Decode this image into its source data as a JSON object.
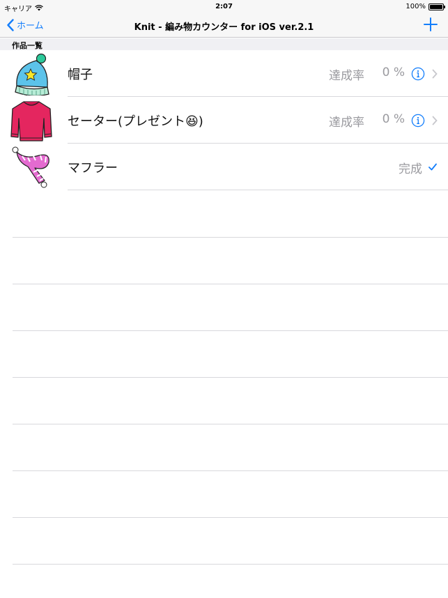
{
  "status_bar": {
    "carrier": "キャリア",
    "time": "2:07",
    "battery": "100%"
  },
  "nav": {
    "back_label": "ホーム",
    "title": "Knit - 編み物カウンター for iOS ver.2.1",
    "add_icon": "plus-icon"
  },
  "section": {
    "title": "作品一覧"
  },
  "items": [
    {
      "title": "帽子",
      "label": "達成率",
      "percent": "0 %",
      "status": "in-progress",
      "icon": "knit-hat-icon"
    },
    {
      "title": "セーター(プレゼント😆)",
      "label": "達成率",
      "percent": "0 %",
      "status": "in-progress",
      "icon": "sweater-icon"
    },
    {
      "title": "マフラー",
      "label": "完成",
      "status": "complete",
      "icon": "scarf-icon"
    }
  ],
  "colors": {
    "accent": "#147efb",
    "secondary_text": "#9a9a9f",
    "separator": "#d8d8dc",
    "nav_background": "#f7f7f7"
  }
}
